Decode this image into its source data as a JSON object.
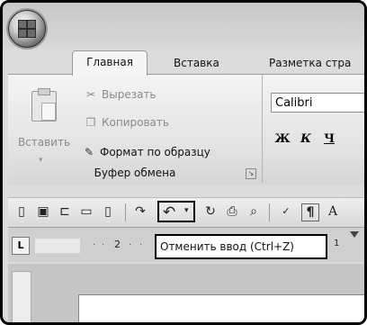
{
  "tabs": {
    "home": "Главная",
    "insert": "Вставка",
    "layout": "Разметка стра"
  },
  "clipboard": {
    "paste_label": "Вставить",
    "cut_label": "Вырезать",
    "copy_label": "Копировать",
    "format_painter_label": "Формат по образцу",
    "group_label": "Буфер обмена"
  },
  "font": {
    "name": "Calibri",
    "bold": "Ж",
    "italic": "К",
    "underline": "Ч"
  },
  "ruler": {
    "mark_2": "2",
    "mark_1": "1"
  },
  "tooltip": {
    "text": "Отменить ввод (Ctrl+Z)"
  },
  "icons": {
    "office_button": "office-logo",
    "undo": "undo-arrow-icon"
  }
}
